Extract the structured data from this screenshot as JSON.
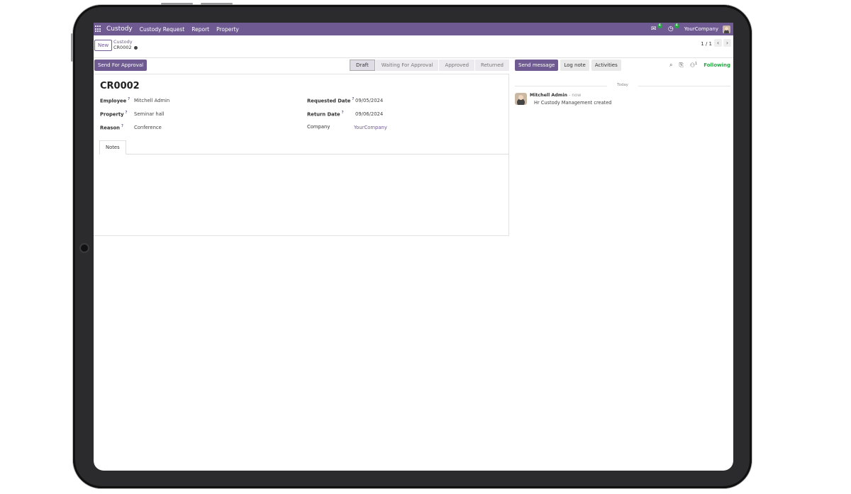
{
  "navbar": {
    "app_name": "Custody",
    "menu": [
      "Custody Request",
      "Report",
      "Property"
    ],
    "messages_badge": "4",
    "activities_badge": "4",
    "company": "YourCompany"
  },
  "control": {
    "new_label": "New",
    "breadcrumb_parent": "Custody",
    "breadcrumb_current": "CR0002",
    "pager": "1 / 1"
  },
  "status": {
    "action_label": "Send For Approval",
    "stages": [
      "Draft",
      "Waiting For Approval",
      "Approved",
      "Returned"
    ],
    "active_stage": "Draft"
  },
  "form": {
    "record_name": "CR0002",
    "fields": {
      "employee_label": "Employee",
      "employee_value": "Mitchell Admin",
      "property_label": "Property",
      "property_value": "Seminar hall",
      "reason_label": "Reason",
      "reason_value": "Conference",
      "requested_date_label": "Requested Date",
      "requested_date_value": "09/05/2024",
      "return_date_label": "Return Date",
      "return_date_value": "09/06/2024",
      "company_label": "Company",
      "company_value": "YourCompany"
    },
    "tab_notes": "Notes"
  },
  "chatter": {
    "send_message": "Send message",
    "log_note": "Log note",
    "activities": "Activities",
    "followers_count": "1",
    "following": "Following",
    "day": "Today",
    "message": {
      "author": "Mitchell Admin",
      "time": "- now",
      "body": "Hr Custody Management created"
    }
  },
  "colors": {
    "brand": "#6f5b91",
    "success": "#28a745"
  }
}
